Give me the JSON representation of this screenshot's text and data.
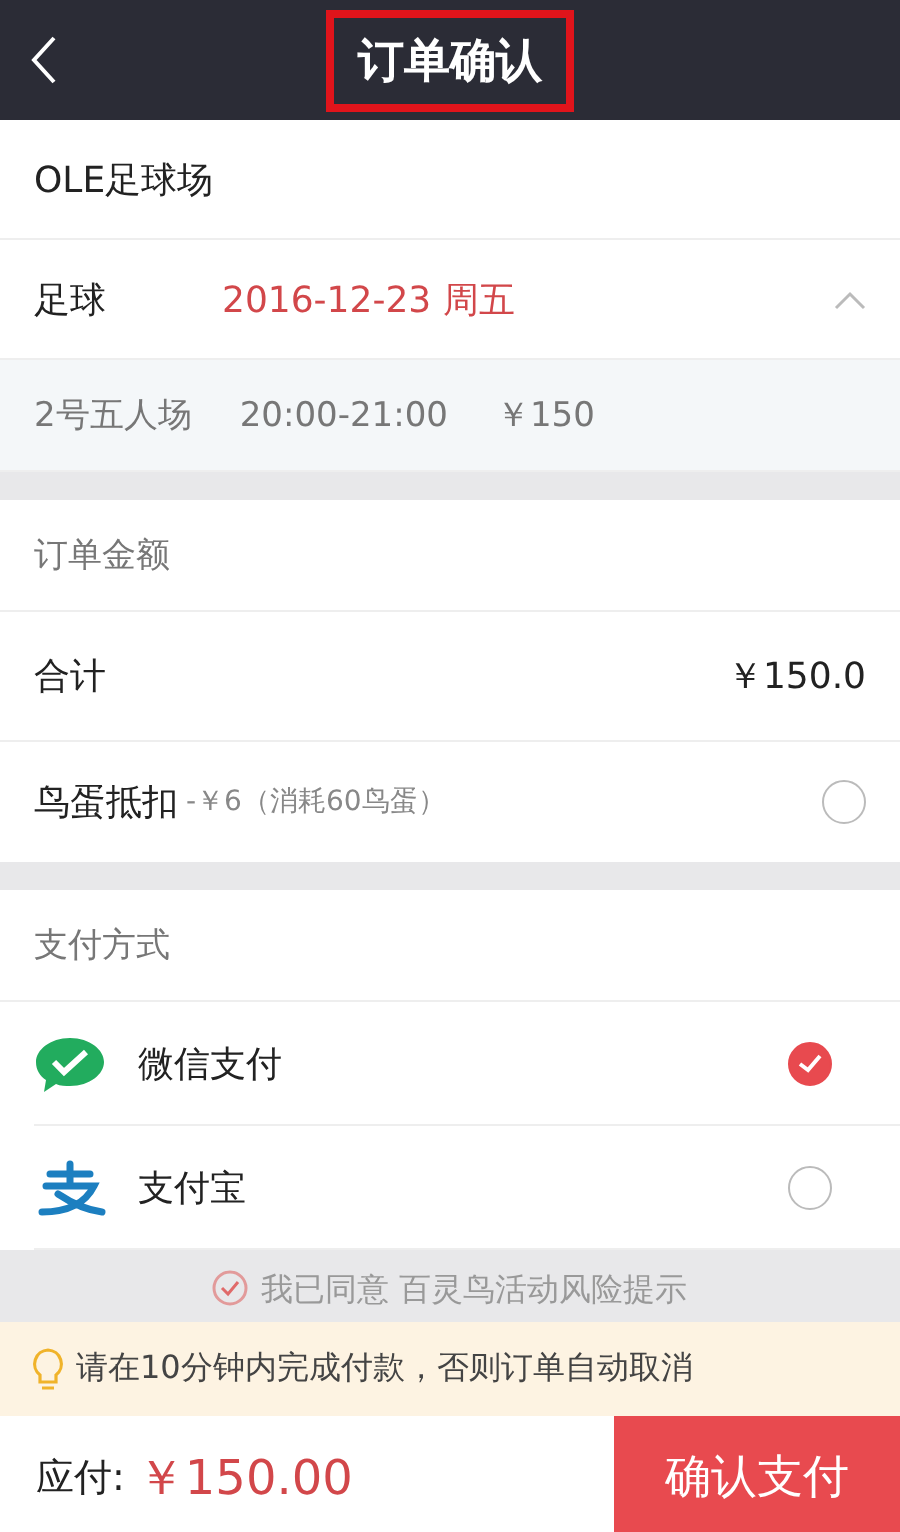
{
  "header": {
    "title": "订单确认",
    "highlighted": true
  },
  "venue": "OLE足球场",
  "booking": {
    "sport": "足球",
    "date": "2016-12-23 周五",
    "expanded": true,
    "slots": [
      {
        "court": "2号五人场",
        "time": "20:00-21:00",
        "price": "￥150"
      }
    ]
  },
  "amount": {
    "heading": "订单金额",
    "total_label": "合计",
    "total": "￥150.0",
    "discount": {
      "label": "鸟蛋抵扣",
      "detail": "-￥6（消耗60鸟蛋）",
      "checked": false
    }
  },
  "payment": {
    "heading": "支付方式",
    "methods": [
      {
        "kind": "wechat",
        "label": "微信支付",
        "selected": true
      },
      {
        "kind": "alipay",
        "label": "支付宝",
        "selected": false
      }
    ]
  },
  "agreement": {
    "text": "我已同意 百灵鸟活动风险提示",
    "checked": true
  },
  "notice": "请在10分钟内完成付款，否则订单自动取消",
  "footer": {
    "due_label": "应付:",
    "due": "￥150.00",
    "button": "确认支付"
  }
}
